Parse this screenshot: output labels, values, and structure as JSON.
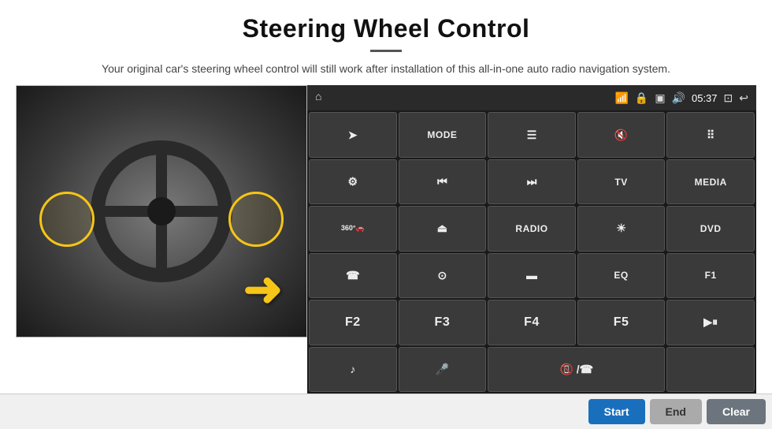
{
  "header": {
    "title": "Steering Wheel Control",
    "subtitle": "Your original car's steering wheel control will still work after installation of this all-in-one auto radio navigation system."
  },
  "top_bar": {
    "time": "05:37",
    "home_icon": "⌂",
    "wifi_icon": "📶",
    "lock_icon": "🔒",
    "sd_icon": "💾",
    "bt_icon": "🔊",
    "window_icon": "⊡",
    "back_icon": "↩"
  },
  "grid_buttons": [
    {
      "id": "btn-nav",
      "type": "icon",
      "icon": "➤",
      "label": "navigation"
    },
    {
      "id": "btn-mode",
      "type": "text",
      "text": "MODE",
      "label": "mode"
    },
    {
      "id": "btn-list",
      "type": "icon",
      "icon": "☰",
      "label": "list"
    },
    {
      "id": "btn-mute",
      "type": "icon",
      "icon": "🔇",
      "label": "mute"
    },
    {
      "id": "btn-apps",
      "type": "icon",
      "icon": "⠿",
      "label": "apps"
    },
    {
      "id": "btn-settings",
      "type": "icon",
      "icon": "⚙",
      "label": "settings"
    },
    {
      "id": "btn-prev",
      "type": "icon",
      "icon": "⏮",
      "label": "previous"
    },
    {
      "id": "btn-next",
      "type": "icon",
      "icon": "⏭",
      "label": "next"
    },
    {
      "id": "btn-tv",
      "type": "text",
      "text": "TV",
      "label": "tv"
    },
    {
      "id": "btn-media",
      "type": "text",
      "text": "MEDIA",
      "label": "media"
    },
    {
      "id": "btn-360",
      "type": "icon",
      "icon": "🚗",
      "label": "360-camera"
    },
    {
      "id": "btn-eject",
      "type": "icon",
      "icon": "⏏",
      "label": "eject"
    },
    {
      "id": "btn-radio",
      "type": "text",
      "text": "RADIO",
      "label": "radio"
    },
    {
      "id": "btn-brightness",
      "type": "icon",
      "icon": "☀",
      "label": "brightness"
    },
    {
      "id": "btn-dvd",
      "type": "text",
      "text": "DVD",
      "label": "dvd"
    },
    {
      "id": "btn-phone",
      "type": "icon",
      "icon": "📞",
      "label": "phone"
    },
    {
      "id": "btn-swipe",
      "type": "icon",
      "icon": "⊙",
      "label": "swipe"
    },
    {
      "id": "btn-screen",
      "type": "icon",
      "icon": "▬",
      "label": "screen"
    },
    {
      "id": "btn-eq",
      "type": "text",
      "text": "EQ",
      "label": "eq"
    },
    {
      "id": "btn-f1",
      "type": "text",
      "text": "F1",
      "label": "f1"
    },
    {
      "id": "btn-f2",
      "type": "text",
      "text": "F2",
      "label": "f2"
    },
    {
      "id": "btn-f3",
      "type": "text",
      "text": "F3",
      "label": "f3"
    },
    {
      "id": "btn-f4",
      "type": "text",
      "text": "F4",
      "label": "f4"
    },
    {
      "id": "btn-f5",
      "type": "text",
      "text": "F5",
      "label": "f5"
    },
    {
      "id": "btn-playpause",
      "type": "icon",
      "icon": "▶⏸",
      "label": "play-pause"
    },
    {
      "id": "btn-music",
      "type": "icon",
      "icon": "♪",
      "label": "music"
    },
    {
      "id": "btn-mic",
      "type": "icon",
      "icon": "🎤",
      "label": "microphone"
    },
    {
      "id": "btn-handsfree",
      "type": "icon",
      "icon": "📵",
      "label": "handsfree"
    }
  ],
  "bottom_bar": {
    "start_label": "Start",
    "end_label": "End",
    "clear_label": "Clear"
  },
  "colors": {
    "start_btn": "#1a6fbd",
    "end_btn": "#999999",
    "clear_btn": "#6c757d",
    "panel_bg": "#1a1a1a",
    "grid_btn_bg": "#3a3a3a"
  }
}
